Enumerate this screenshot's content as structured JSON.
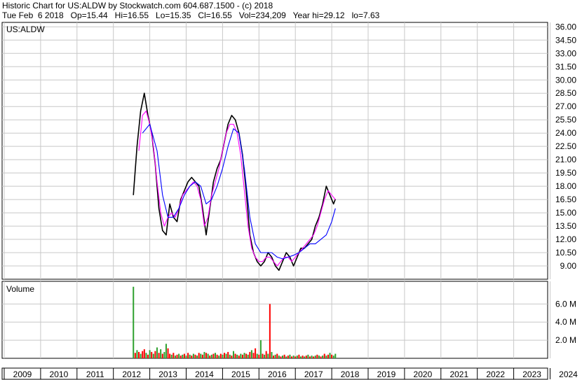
{
  "header": {
    "line1": "Historic Chart for US:ALDW by Stockwatch.com 604.687.1500 - (c) 2018",
    "line2": "Tue Feb  6 2018   Op=15.44   Hi=16.55   Lo=15.35   Cl=16.55   Vol=234,209   Year hi=29.12   lo=7.63"
  },
  "chart_data": [
    {
      "type": "line",
      "title": "US:ALDW",
      "y_ticks": [
        "36.00",
        "34.50",
        "33.00",
        "31.50",
        "30.00",
        "28.50",
        "27.00",
        "25.50",
        "24.00",
        "22.50",
        "21.00",
        "19.50",
        "18.00",
        "16.50",
        "15.00",
        "13.50",
        "12.00",
        "10.50",
        "9.00"
      ],
      "ylim": [
        7.5,
        36.5
      ],
      "grid": true,
      "series": [
        {
          "color": "#000000",
          "x": [
            2012.55,
            2012.65,
            2012.75,
            2012.85,
            2012.95,
            2013.05,
            2013.15,
            2013.25,
            2013.35,
            2013.45,
            2013.55,
            2013.65,
            2013.75,
            2013.85,
            2013.95,
            2014.05,
            2014.15,
            2014.25,
            2014.35,
            2014.45,
            2014.55,
            2014.65,
            2014.75,
            2014.85,
            2014.95,
            2015.05,
            2015.15,
            2015.25,
            2015.35,
            2015.45,
            2015.55,
            2015.65,
            2015.75,
            2015.85,
            2015.95,
            2016.05,
            2016.15,
            2016.25,
            2016.35,
            2016.45,
            2016.55,
            2016.65,
            2016.75,
            2016.85,
            2016.95,
            2017.05,
            2017.15,
            2017.25,
            2017.35,
            2017.45,
            2017.55,
            2017.65,
            2017.75,
            2017.85,
            2017.95,
            2018.05,
            2018.1
          ],
          "y": [
            17.0,
            22.5,
            26.5,
            28.5,
            26.0,
            24.0,
            20.5,
            15.5,
            13.0,
            12.5,
            16.0,
            14.5,
            14.0,
            16.5,
            17.5,
            18.5,
            19.0,
            18.5,
            18.0,
            15.5,
            12.5,
            15.5,
            18.5,
            20.0,
            21.0,
            23.0,
            25.0,
            26.0,
            25.5,
            24.0,
            21.5,
            17.5,
            12.5,
            10.5,
            9.5,
            9.0,
            9.5,
            10.5,
            10.0,
            9.0,
            8.5,
            9.5,
            10.5,
            10.0,
            9.0,
            10.0,
            11.0,
            11.0,
            11.5,
            12.0,
            13.5,
            14.5,
            16.0,
            18.0,
            17.0,
            16.0,
            16.55
          ]
        },
        {
          "color": "#ff00ff",
          "x": [
            2012.7,
            2012.8,
            2012.9,
            2013.0,
            2013.1,
            2013.2,
            2013.3,
            2013.4,
            2013.5,
            2013.6,
            2013.7,
            2013.8,
            2013.9,
            2014.0,
            2014.1,
            2014.2,
            2014.3,
            2014.4,
            2014.5,
            2014.6,
            2014.7,
            2014.8,
            2014.9,
            2015.0,
            2015.1,
            2015.2,
            2015.3,
            2015.4,
            2015.5,
            2015.6,
            2015.7,
            2015.8,
            2015.9,
            2016.0,
            2016.1,
            2016.2,
            2016.3,
            2016.4,
            2016.5,
            2016.6,
            2016.7,
            2016.8,
            2016.9,
            2017.0,
            2017.1,
            2017.2,
            2017.3,
            2017.4,
            2017.5,
            2017.6,
            2017.7,
            2017.8,
            2017.9,
            2018.0,
            2018.1
          ],
          "y": [
            22.0,
            26.0,
            26.5,
            25.0,
            22.5,
            18.5,
            15.0,
            13.5,
            14.5,
            15.0,
            14.5,
            15.5,
            17.0,
            17.5,
            18.0,
            18.5,
            18.0,
            16.5,
            13.5,
            14.5,
            17.0,
            18.5,
            20.0,
            22.0,
            24.0,
            25.0,
            25.0,
            24.0,
            21.5,
            17.5,
            13.5,
            11.0,
            10.0,
            9.5,
            9.5,
            10.0,
            10.0,
            9.5,
            9.0,
            9.5,
            10.0,
            10.0,
            9.5,
            10.0,
            10.5,
            11.0,
            11.5,
            12.0,
            12.5,
            13.5,
            15.0,
            16.5,
            17.5,
            17.0,
            16.5
          ]
        },
        {
          "color": "#0000ff",
          "x": [
            2012.8,
            2013.0,
            2013.2,
            2013.35,
            2013.5,
            2013.65,
            2013.8,
            2013.95,
            2014.1,
            2014.25,
            2014.4,
            2014.55,
            2014.7,
            2014.85,
            2015.0,
            2015.15,
            2015.3,
            2015.45,
            2015.6,
            2015.75,
            2015.9,
            2016.05,
            2016.2,
            2016.35,
            2016.5,
            2016.65,
            2016.8,
            2016.95,
            2017.1,
            2017.25,
            2017.4,
            2017.55,
            2017.7,
            2017.85,
            2018.0,
            2018.1
          ],
          "y": [
            24.0,
            25.0,
            22.0,
            17.0,
            14.5,
            14.5,
            15.5,
            17.0,
            18.0,
            18.5,
            18.0,
            16.0,
            16.5,
            18.0,
            20.0,
            22.5,
            24.5,
            24.0,
            20.0,
            14.5,
            11.5,
            10.5,
            10.5,
            10.5,
            10.0,
            9.8,
            10.0,
            10.2,
            10.5,
            11.0,
            11.5,
            11.5,
            12.0,
            12.5,
            14.0,
            15.5
          ]
        }
      ]
    },
    {
      "type": "bar",
      "title": "Volume",
      "y_ticks": [
        "6.0 M",
        "4.0 M",
        "2.0 M"
      ],
      "ylim": [
        0,
        8.5
      ],
      "x_ticks": [
        "2009",
        "2010",
        "2011",
        "2012",
        "2013",
        "2014",
        "2015",
        "2016",
        "2017",
        "2018",
        "2019",
        "2020",
        "2021",
        "2022",
        "2023",
        "2024"
      ],
      "grid": true,
      "x": [
        2012.55,
        2012.6,
        2012.65,
        2012.7,
        2012.75,
        2012.8,
        2012.85,
        2012.9,
        2012.95,
        2013.0,
        2013.05,
        2013.1,
        2013.15,
        2013.2,
        2013.25,
        2013.3,
        2013.35,
        2013.4,
        2013.45,
        2013.5,
        2013.55,
        2013.6,
        2013.65,
        2013.7,
        2013.75,
        2013.8,
        2013.85,
        2013.9,
        2013.95,
        2014.0,
        2014.05,
        2014.1,
        2014.15,
        2014.2,
        2014.25,
        2014.3,
        2014.35,
        2014.4,
        2014.45,
        2014.5,
        2014.55,
        2014.6,
        2014.65,
        2014.7,
        2014.75,
        2014.8,
        2014.85,
        2014.9,
        2014.95,
        2015.0,
        2015.05,
        2015.1,
        2015.15,
        2015.2,
        2015.25,
        2015.3,
        2015.35,
        2015.4,
        2015.45,
        2015.5,
        2015.55,
        2015.6,
        2015.65,
        2015.7,
        2015.75,
        2015.8,
        2015.85,
        2015.9,
        2015.95,
        2016.0,
        2016.05,
        2016.1,
        2016.15,
        2016.2,
        2016.25,
        2016.3,
        2016.35,
        2016.4,
        2016.45,
        2016.5,
        2016.55,
        2016.6,
        2016.65,
        2016.7,
        2016.75,
        2016.8,
        2016.85,
        2016.9,
        2016.95,
        2017.0,
        2017.05,
        2017.1,
        2017.15,
        2017.2,
        2017.25,
        2017.3,
        2017.35,
        2017.4,
        2017.45,
        2017.5,
        2017.55,
        2017.6,
        2017.65,
        2017.7,
        2017.75,
        2017.8,
        2017.85,
        2017.9,
        2017.95,
        2018.0,
        2018.05,
        2018.1
      ],
      "values": [
        7.9,
        0.6,
        0.9,
        0.7,
        0.5,
        0.8,
        1.0,
        0.6,
        0.4,
        0.9,
        0.7,
        0.5,
        0.8,
        1.2,
        0.6,
        1.0,
        0.5,
        0.7,
        1.6,
        1.1,
        0.5,
        0.4,
        0.6,
        0.3,
        0.4,
        0.5,
        0.3,
        0.4,
        0.5,
        0.3,
        0.6,
        0.4,
        0.3,
        0.5,
        0.4,
        0.3,
        0.6,
        0.5,
        0.4,
        0.7,
        0.6,
        0.5,
        0.3,
        0.4,
        0.5,
        0.6,
        0.4,
        0.3,
        0.5,
        0.4,
        0.6,
        0.5,
        0.7,
        0.4,
        0.3,
        0.8,
        0.5,
        0.4,
        0.3,
        0.5,
        0.4,
        0.6,
        0.5,
        0.4,
        0.7,
        0.9,
        0.6,
        1.1,
        0.5,
        0.4,
        2.0,
        0.5,
        0.4,
        0.8,
        0.5,
        6.0,
        0.7,
        0.3,
        0.4,
        0.5,
        0.3,
        0.2,
        0.3,
        0.4,
        0.2,
        0.3,
        0.4,
        0.2,
        0.3,
        0.2,
        0.3,
        0.4,
        0.2,
        0.3,
        0.2,
        0.3,
        0.4,
        0.2,
        0.3,
        0.2,
        0.3,
        0.4,
        0.3,
        0.2,
        0.3,
        0.5,
        0.3,
        0.4,
        0.6,
        0.4,
        0.3,
        0.5
      ],
      "colors": [
        "#2ea02e",
        "#ff0000",
        "#2ea02e",
        "#ff0000",
        "#2ea02e",
        "#ff0000",
        "#ff0000",
        "#2ea02e",
        "#ff0000",
        "#2ea02e",
        "#ff0000",
        "#2ea02e",
        "#ff0000",
        "#2ea02e",
        "#ff0000",
        "#2ea02e",
        "#ff0000",
        "#2ea02e",
        "#2ea02e",
        "#ff0000",
        "#ff0000",
        "#2ea02e",
        "#ff0000",
        "#2ea02e",
        "#ff0000",
        "#2ea02e",
        "#ff0000",
        "#2ea02e",
        "#ff0000",
        "#2ea02e",
        "#ff0000",
        "#2ea02e",
        "#ff0000",
        "#2ea02e",
        "#ff0000",
        "#2ea02e",
        "#ff0000",
        "#2ea02e",
        "#ff0000",
        "#2ea02e",
        "#ff0000",
        "#2ea02e",
        "#ff0000",
        "#2ea02e",
        "#ff0000",
        "#2ea02e",
        "#ff0000",
        "#2ea02e",
        "#ff0000",
        "#2ea02e",
        "#ff0000",
        "#2ea02e",
        "#ff0000",
        "#2ea02e",
        "#ff0000",
        "#2ea02e",
        "#ff0000",
        "#2ea02e",
        "#ff0000",
        "#2ea02e",
        "#ff0000",
        "#2ea02e",
        "#ff0000",
        "#2ea02e",
        "#ff0000",
        "#2ea02e",
        "#ff0000",
        "#ff0000",
        "#2ea02e",
        "#ff0000",
        "#2ea02e",
        "#ff0000",
        "#2ea02e",
        "#ff0000",
        "#2ea02e",
        "#ff0000",
        "#2ea02e",
        "#ff0000",
        "#2ea02e",
        "#ff0000",
        "#2ea02e",
        "#ff0000",
        "#2ea02e",
        "#ff0000",
        "#2ea02e",
        "#ff0000",
        "#2ea02e",
        "#ff0000",
        "#2ea02e",
        "#ff0000",
        "#2ea02e",
        "#ff0000",
        "#2ea02e",
        "#ff0000",
        "#2ea02e",
        "#ff0000",
        "#2ea02e",
        "#ff0000",
        "#2ea02e",
        "#ff0000",
        "#2ea02e",
        "#ff0000",
        "#2ea02e",
        "#ff0000",
        "#2ea02e",
        "#ff0000",
        "#2ea02e",
        "#ff0000",
        "#2ea02e",
        "#ff0000",
        "#2ea02e",
        "#2ea02e"
      ]
    }
  ]
}
